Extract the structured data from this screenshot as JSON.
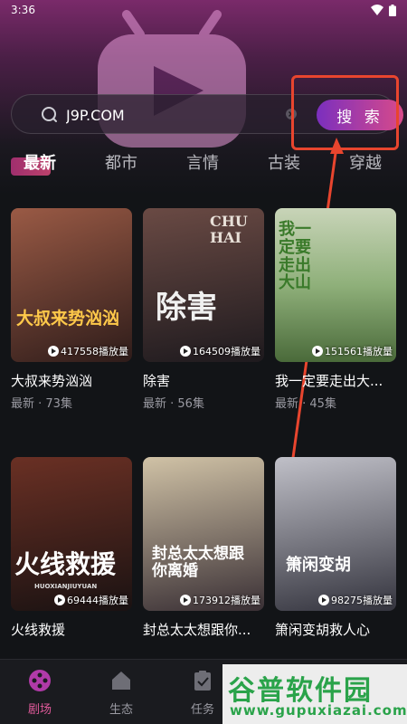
{
  "status": {
    "time": "3:36"
  },
  "search": {
    "value": "J9P.COM",
    "button_label": "搜 索"
  },
  "tabs": [
    {
      "label": "最新",
      "active": true
    },
    {
      "label": "都市"
    },
    {
      "label": "言情"
    },
    {
      "label": "古装"
    },
    {
      "label": "穿越"
    }
  ],
  "dramas": [
    {
      "name": "大叔来势汹汹",
      "meta": "最新 · 73集",
      "views": "417558播放量",
      "poster_text": "大叔来势汹汹",
      "poster_colors": [
        "#8a4a3a",
        "#3a2220"
      ]
    },
    {
      "name": "除害",
      "meta": "最新 · 56集",
      "views": "164509播放量",
      "poster_text": "除害",
      "poster_top_text": "CHU HAI",
      "poster_colors": [
        "#5a3f3a",
        "#1e1a1e"
      ]
    },
    {
      "name": "我一定要走出大...",
      "meta": "最新 · 45集",
      "views": "151561播放量",
      "poster_text": "我一定要走出大山",
      "poster_colors": [
        "#8fb07a",
        "#4a6a3a"
      ]
    },
    {
      "name": "火线救援",
      "meta": "",
      "views": "69444播放量",
      "poster_text": "火线救援",
      "poster_sub": "HUOXIANJIUYUAN",
      "poster_colors": [
        "#5a2a20",
        "#1a1212"
      ]
    },
    {
      "name": "封总太太想跟你...",
      "meta": "",
      "views": "173912播放量",
      "poster_text": "封总太太想跟你离婚",
      "poster_colors": [
        "#c8b89a",
        "#3a3035"
      ]
    },
    {
      "name": "箫闲变胡救人心",
      "meta": "",
      "views": "98275播放量",
      "poster_text": "箫闲变胡",
      "poster_colors": [
        "#b8b8c0",
        "#3a3a44"
      ]
    }
  ],
  "bottom_nav": [
    {
      "label": "剧场",
      "icon": "film-reel-icon",
      "active": true
    },
    {
      "label": "生态",
      "icon": "home-icon"
    },
    {
      "label": "任务",
      "icon": "clipboard-icon"
    }
  ],
  "watermark": {
    "logo": "谷普软件园",
    "url": "www.gupuxiazai.com"
  },
  "colors": {
    "accent": "#d84a8a",
    "highlight": "#e8452e",
    "watermark": "#2aa34a"
  }
}
